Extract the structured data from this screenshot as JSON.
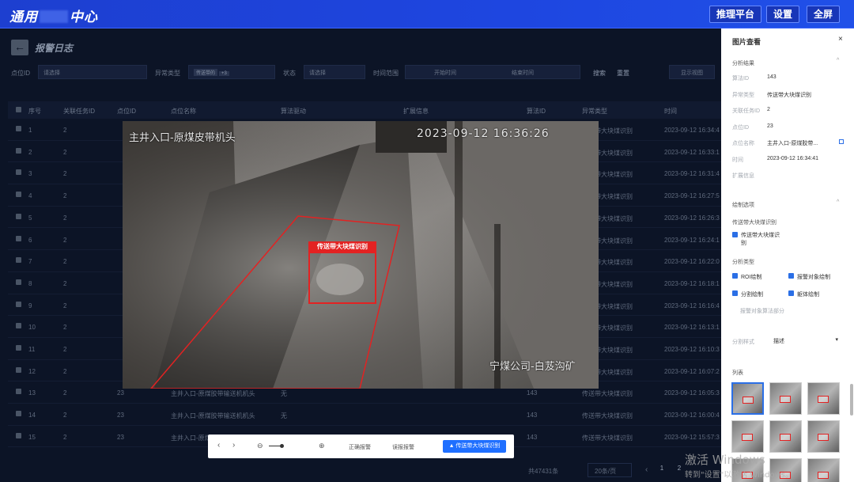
{
  "app": {
    "title_prefix": "通用",
    "title_suffix": "中心"
  },
  "topbar": {
    "buttons": [
      "推理平台",
      "设置",
      "全屏"
    ]
  },
  "page": {
    "back_icon": "←",
    "title": "报警日志"
  },
  "filters": {
    "point_label": "点位ID",
    "point_placeholder": "请选择",
    "type_label": "异常类型",
    "type_tag": "传送带的",
    "type_count": "+3",
    "status_label": "状态",
    "status_placeholder": "请选择",
    "time_label": "时间范围",
    "start_placeholder": "开始时间",
    "end_placeholder": "结束时间",
    "search": "搜索",
    "reset": "重置",
    "display": "显示视图"
  },
  "table": {
    "headers": [
      "序号",
      "关联任务ID",
      "点位ID",
      "点位名称",
      "算法驱动",
      "扩展信息",
      "算法ID",
      "异常类型",
      "时间"
    ],
    "rows": [
      {
        "no": "1",
        "task": "2",
        "point": "",
        "name": "",
        "algo": "",
        "ext": "",
        "aid": "",
        "type": "传送带大块煤识别",
        "time": "2023-09-12 16:34:4"
      },
      {
        "no": "2",
        "task": "2",
        "point": "",
        "name": "",
        "algo": "",
        "ext": "",
        "aid": "",
        "type": "传送带大块煤识别",
        "time": "2023-09-12 16:33:1"
      },
      {
        "no": "3",
        "task": "2",
        "point": "",
        "name": "",
        "algo": "",
        "ext": "",
        "aid": "",
        "type": "传送带大块煤识别",
        "time": "2023-09-12 16:31:4"
      },
      {
        "no": "4",
        "task": "2",
        "point": "",
        "name": "",
        "algo": "",
        "ext": "",
        "aid": "",
        "type": "传送带大块煤识别",
        "time": "2023-09-12 16:27:5"
      },
      {
        "no": "5",
        "task": "2",
        "point": "",
        "name": "",
        "algo": "",
        "ext": "",
        "aid": "",
        "type": "传送带大块煤识别",
        "time": "2023-09-12 16:26:3"
      },
      {
        "no": "6",
        "task": "2",
        "point": "",
        "name": "",
        "algo": "",
        "ext": "",
        "aid": "",
        "type": "传送带大块煤识别",
        "time": "2023-09-12 16:24:1"
      },
      {
        "no": "7",
        "task": "2",
        "point": "",
        "name": "",
        "algo": "",
        "ext": "",
        "aid": "",
        "type": "传送带大块煤识别",
        "time": "2023-09-12 16:22:0"
      },
      {
        "no": "8",
        "task": "2",
        "point": "",
        "name": "",
        "algo": "",
        "ext": "",
        "aid": "",
        "type": "传送带大块煤识别",
        "time": "2023-09-12 16:18:1"
      },
      {
        "no": "9",
        "task": "2",
        "point": "",
        "name": "",
        "algo": "",
        "ext": "",
        "aid": "",
        "type": "传送带大块煤识别",
        "time": "2023-09-12 16:16:4"
      },
      {
        "no": "10",
        "task": "2",
        "point": "",
        "name": "",
        "algo": "",
        "ext": "",
        "aid": "",
        "type": "传送带大块煤识别",
        "time": "2023-09-12 16:13:1"
      },
      {
        "no": "11",
        "task": "2",
        "point": "",
        "name": "",
        "algo": "",
        "ext": "",
        "aid": "",
        "type": "传送带大块煤识别",
        "time": "2023-09-12 16:10:3"
      },
      {
        "no": "12",
        "task": "2",
        "point": "",
        "name": "",
        "algo": "",
        "ext": "",
        "aid": "",
        "type": "传送带大块煤识别",
        "time": "2023-09-12 16:07:2"
      },
      {
        "no": "13",
        "task": "2",
        "point": "23",
        "name": "主井入口-原煤胶带输送机机头",
        "algo": "无",
        "ext": "",
        "aid": "143",
        "type": "传送带大块煤识别",
        "time": "2023-09-12 16:05:3"
      },
      {
        "no": "14",
        "task": "2",
        "point": "23",
        "name": "主井入口-原煤胶带输送机机头",
        "algo": "无",
        "ext": "",
        "aid": "143",
        "type": "传送带大块煤识别",
        "time": "2023-09-12 16:00:4"
      },
      {
        "no": "15",
        "task": "2",
        "point": "23",
        "name": "主井入口-原煤胶带输送机机头",
        "algo": "无",
        "ext": "",
        "aid": "143",
        "type": "传送带大块煤识别",
        "time": "2023-09-12 15:57:3"
      }
    ]
  },
  "footer": {
    "total": "共47431条",
    "page_size": "20条/页",
    "prev": "‹",
    "pages": [
      "1",
      "2"
    ]
  },
  "camera": {
    "location": "主井入口-原煤皮带机头",
    "timestamp": "2023-09-12 16:36:26",
    "company": "宁煤公司-白芨沟矿",
    "detection_label": "传送带大块煤识别"
  },
  "controls": {
    "prev": "‹",
    "next": "›",
    "zoom_out": "⊖",
    "zoom_in": "⊕",
    "correct": "正确报警",
    "false_alarm": "误报报警",
    "class_btn": "▲ 传送带大块煤识别"
  },
  "panel": {
    "title": "图片查看",
    "close": "×",
    "section1": "分析结果",
    "fields": [
      {
        "label": "算法ID",
        "value": "143"
      },
      {
        "label": "异常类型",
        "value": "传送带大块煤识别"
      },
      {
        "label": "关联任务ID",
        "value": "2"
      },
      {
        "label": "点位ID",
        "value": "23"
      },
      {
        "label": "点位名称",
        "value": "主井入口-原煤胶带..."
      },
      {
        "label": "时间",
        "value": "2023-09-12 16:34:41"
      },
      {
        "label": "扩展信息",
        "value": ""
      }
    ],
    "section2": "绘制选项",
    "sub_a": "传送带大块煤识别",
    "chk_a": "传送带大块煤识别",
    "sub_b": "分析类型",
    "chk_b": [
      "ROI绘制",
      "报警对象绘制",
      "分割绘制",
      "躯体绘制"
    ],
    "note": "报警对象算法部分",
    "style_label": "分割样式",
    "style_value": "描述",
    "list_label": "列表"
  },
  "watermark": {
    "line1": "激活 Windows",
    "line2": "转到\"设置\"以激活 Windows。"
  }
}
